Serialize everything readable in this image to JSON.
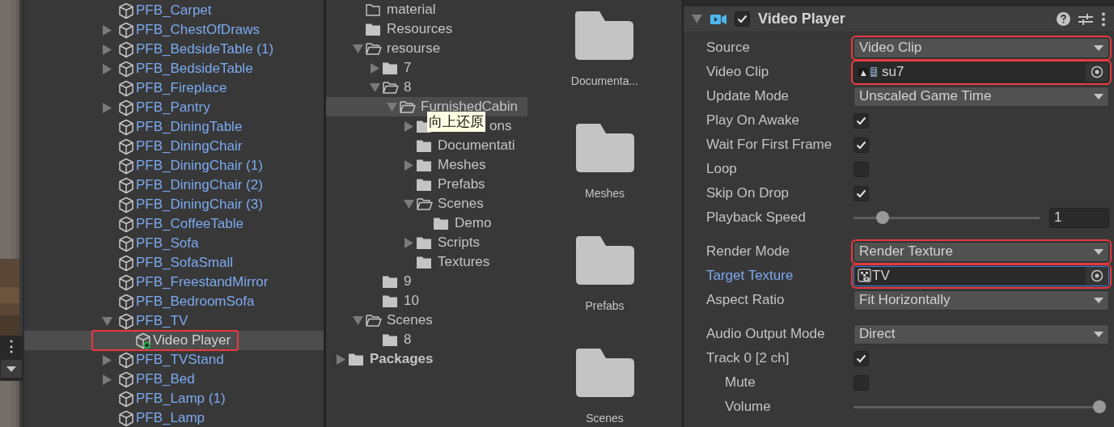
{
  "scene_toolbar": {
    "menu": "⋮"
  },
  "hierarchy": {
    "items": [
      {
        "name": "PFB_Carpet",
        "kind": "prefab",
        "selected": false,
        "annotated": false
      },
      {
        "name": "PFB_ChestOfDraws",
        "expanded": false,
        "kind": "prefab",
        "selected": false,
        "annotated": false
      },
      {
        "name": "PFB_BedsideTable (1)",
        "expanded": false,
        "kind": "prefab",
        "selected": false,
        "annotated": false
      },
      {
        "name": "PFB_BedsideTable",
        "expanded": false,
        "kind": "prefab",
        "selected": false,
        "annotated": false
      },
      {
        "name": "PFB_Fireplace",
        "kind": "prefab",
        "selected": false,
        "annotated": false
      },
      {
        "name": "PFB_Pantry",
        "expanded": false,
        "kind": "prefab",
        "selected": false,
        "annotated": false
      },
      {
        "name": "PFB_DiningTable",
        "kind": "prefab",
        "selected": false,
        "annotated": false
      },
      {
        "name": "PFB_DiningChair",
        "kind": "prefab",
        "selected": false,
        "annotated": false
      },
      {
        "name": "PFB_DiningChair (1)",
        "kind": "prefab",
        "selected": false,
        "annotated": false
      },
      {
        "name": "PFB_DiningChair (2)",
        "kind": "prefab",
        "selected": false,
        "annotated": false
      },
      {
        "name": "PFB_DiningChair (3)",
        "kind": "prefab",
        "selected": false,
        "annotated": false
      },
      {
        "name": "PFB_CoffeeTable",
        "kind": "prefab",
        "selected": false,
        "annotated": false
      },
      {
        "name": "PFB_Sofa",
        "kind": "prefab",
        "selected": false,
        "annotated": false
      },
      {
        "name": "PFB_SofaSmall",
        "kind": "prefab",
        "selected": false,
        "annotated": false
      },
      {
        "name": "PFB_FreestandMirror",
        "kind": "prefab",
        "selected": false,
        "annotated": false
      },
      {
        "name": "PFB_BedroomSofa",
        "kind": "prefab",
        "selected": false,
        "annotated": false
      },
      {
        "name": "PFB_TV",
        "expanded": true,
        "kind": "prefab",
        "selected": false,
        "annotated": false,
        "children": [
          {
            "name": "Video Player",
            "kind": "added",
            "selected": true,
            "annotated": true
          }
        ]
      },
      {
        "name": "PFB_TVStand",
        "expanded": false,
        "kind": "prefab",
        "selected": false,
        "annotated": false
      },
      {
        "name": "PFB_Bed",
        "expanded": false,
        "kind": "prefab",
        "selected": false,
        "annotated": false
      },
      {
        "name": "PFB_Lamp (1)",
        "kind": "prefab",
        "selected": false,
        "annotated": false
      },
      {
        "name": "PFB_Lamp",
        "kind": "prefab",
        "selected": false,
        "annotated": false
      }
    ]
  },
  "project_tree": {
    "assets_items": [
      {
        "name": "material",
        "kind": "empty",
        "selected": false
      },
      {
        "name": "Resources",
        "kind": "folder",
        "selected": false
      },
      {
        "name": "resourse",
        "expanded": true,
        "kind": "folder",
        "selected": false,
        "children": [
          {
            "name": "7",
            "expanded": false,
            "kind": "folder",
            "selected": false
          },
          {
            "name": "8",
            "expanded": true,
            "kind": "folder",
            "selected": false,
            "children": [
              {
                "name": "FurnishedCabin",
                "expanded": true,
                "kind": "folder",
                "selected": true,
                "children": [
                  {
                    "name": "ons",
                    "expanded": false,
                    "kind": "folder",
                    "selected": false
                  },
                  {
                    "name": "Documentati",
                    "kind": "folder",
                    "selected": false
                  },
                  {
                    "name": "Meshes",
                    "expanded": false,
                    "kind": "folder",
                    "selected": false
                  },
                  {
                    "name": "Prefabs",
                    "kind": "folder",
                    "selected": false
                  },
                  {
                    "name": "Scenes",
                    "expanded": true,
                    "kind": "folder",
                    "selected": false,
                    "children": [
                      {
                        "name": "Demo",
                        "kind": "folder",
                        "selected": false
                      }
                    ]
                  },
                  {
                    "name": "Scripts",
                    "expanded": false,
                    "kind": "folder",
                    "selected": false
                  },
                  {
                    "name": "Textures",
                    "kind": "folder",
                    "selected": false
                  }
                ]
              }
            ]
          },
          {
            "name": "9",
            "kind": "folder",
            "selected": false
          },
          {
            "name": "10",
            "kind": "folder",
            "selected": false
          }
        ]
      },
      {
        "name": "Scenes",
        "expanded": true,
        "kind": "folder",
        "selected": false,
        "children": [
          {
            "name": "8",
            "kind": "folder",
            "selected": false
          }
        ]
      }
    ],
    "roots": [
      {
        "name": "Packages",
        "expanded": false,
        "kind": "folder",
        "selected": false
      }
    ],
    "tooltip": "向上还原"
  },
  "project_grid": {
    "items": [
      {
        "name": "Documenta..."
      },
      {
        "name": "Meshes"
      },
      {
        "name": "Prefabs"
      },
      {
        "name": "Scenes"
      }
    ]
  },
  "inspector": {
    "component": {
      "title": "Video Player",
      "enabled": true,
      "expanded": true
    },
    "groups": [
      {
        "rows": [
          {
            "label": "Source",
            "kind": "dropdown",
            "value": "Video Clip",
            "annotated": true
          },
          {
            "label": "Video Clip",
            "kind": "video-object",
            "value": "su7",
            "annotated": true,
            "focused": false
          },
          {
            "label": "Update Mode",
            "kind": "dropdown",
            "value": "Unscaled Game Time",
            "annotated": false
          },
          {
            "label": "Play On Awake",
            "kind": "checkbox",
            "checked": true
          },
          {
            "label": "Wait For First Frame",
            "kind": "checkbox",
            "checked": true
          },
          {
            "label": "Loop",
            "kind": "checkbox",
            "checked": false
          },
          {
            "label": "Skip On Drop",
            "kind": "checkbox",
            "checked": true
          },
          {
            "label": "Playback Speed",
            "kind": "slider",
            "level": 0.13,
            "value": "1"
          }
        ]
      },
      {
        "rows": [
          {
            "label": "Render Mode",
            "kind": "dropdown",
            "value": "Render Texture",
            "annotated": true
          },
          {
            "label": "Target Texture",
            "kind": "texture-object",
            "value": "TV",
            "annotated": true,
            "focused": true,
            "modified": true
          },
          {
            "label": "Aspect Ratio",
            "kind": "dropdown",
            "value": "Fit Horizontally",
            "annotated": false
          }
        ]
      },
      {
        "rows": [
          {
            "label": "Audio Output Mode",
            "kind": "dropdown",
            "value": "Direct",
            "annotated": false
          },
          {
            "label": "Track 0 [2 ch]",
            "kind": "checkbox",
            "checked": true,
            "children": [
              {
                "label": "Mute",
                "kind": "checkbox",
                "checked": false
              },
              {
                "label": "Volume",
                "kind": "slider",
                "level": 1
              }
            ]
          }
        ]
      }
    ]
  }
}
